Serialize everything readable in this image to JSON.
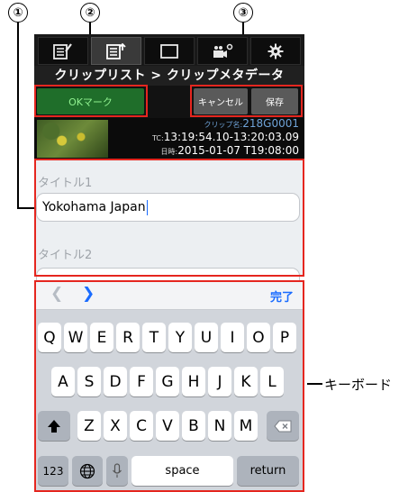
{
  "callouts": [
    "①",
    "②",
    "③"
  ],
  "toolbar": {
    "tabs": [
      {
        "icon": "clip-list-edit-icon"
      },
      {
        "icon": "clip-metadata-icon"
      },
      {
        "icon": "monitor-icon"
      },
      {
        "icon": "camera-settings-icon"
      },
      {
        "icon": "gear-icon"
      }
    ]
  },
  "navbar": {
    "title": "クリップリスト > クリップメタデータ"
  },
  "buttons": {
    "ok_mark": "OKマーク",
    "cancel": "キャンセル",
    "save": "保存"
  },
  "clip": {
    "clip_name_label": "クリップ名:",
    "clip_name": "218G0001",
    "tc_label": "TC:",
    "tc": "13:19:54.10-13:20:03.09",
    "date_label": "日時:",
    "date": "2015-01-07 T19:08:00"
  },
  "form": {
    "title1_label": "タイトル1",
    "title1_value": "Yokohama Japan",
    "title2_label": "タイトル2"
  },
  "keyboard": {
    "done": "完了",
    "row1": [
      "Q",
      "W",
      "E",
      "R",
      "T",
      "Y",
      "U",
      "I",
      "O",
      "P"
    ],
    "row2": [
      "A",
      "S",
      "D",
      "F",
      "G",
      "H",
      "J",
      "K",
      "L"
    ],
    "row3": [
      "Z",
      "X",
      "C",
      "V",
      "B",
      "N",
      "M"
    ],
    "numbers": "123",
    "space": "space",
    "return": "return"
  },
  "annotation": {
    "keyboard_label": "キーボード"
  },
  "colors": {
    "highlight": "#e5261f",
    "ok_button": "#1f6e2a",
    "accent": "#1a6cff"
  }
}
